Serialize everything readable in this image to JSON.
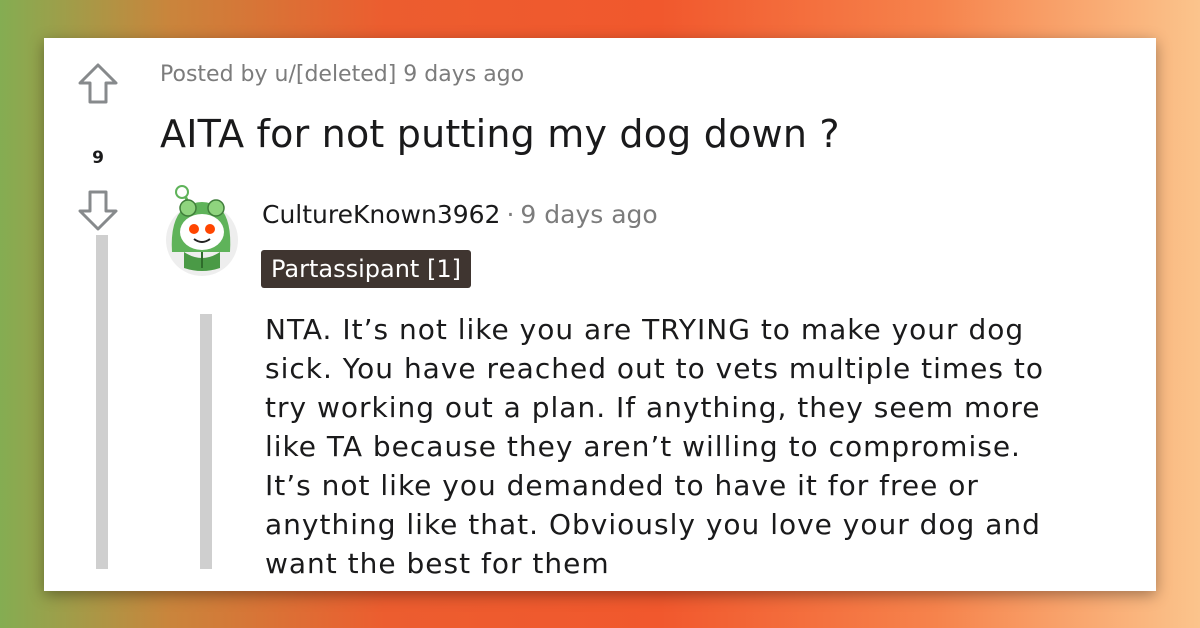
{
  "post": {
    "score": "9",
    "meta": "Posted by u/[deleted] 9 days ago",
    "title": "AITA for not putting my dog down ?"
  },
  "comment": {
    "author": "CultureKnown3962",
    "separator": "·",
    "time": "9 days ago",
    "flair": "Partassipant [1]",
    "avatar": "snoo-frog-hood-avatar",
    "body": "NTA. It’s not like you are TRYING to make your dog\nsick. You have reached out to vets multiple times to\ntry working out a plan. If anything, they seem more\nlike TA because they aren’t willing to compromise.\nIt’s not like you demanded to have it for free or\nanything like that. Obviously you love your dog and\nwant the best for them"
  },
  "icons": {
    "upvote": "arrow-up-icon",
    "downvote": "arrow-down-icon"
  },
  "colors": {
    "flair_bg": "#3f3530",
    "meta_text": "#7c7c7c",
    "thread_line": "#cfcfcf",
    "avatar_green": "#5fb35a"
  }
}
